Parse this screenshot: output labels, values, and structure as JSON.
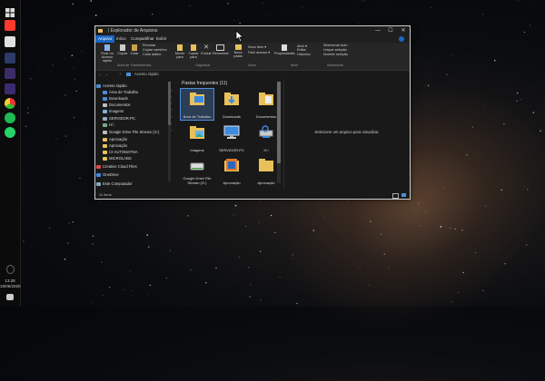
{
  "window": {
    "title": "| Explorador de Arquivos",
    "controls": {
      "minimize": "—",
      "maximize": "☐",
      "close": "✕"
    }
  },
  "tabs": [
    "Arquivo",
    "Início",
    "Compartilhar",
    "Exibir"
  ],
  "ribbon": {
    "pin": "Fixar no Acesso rápido",
    "copy": "Copiar",
    "paste": "Colar",
    "cut": "Recortar",
    "copy_path": "Copiar caminho",
    "paste_shortcut": "Colar atalho",
    "move_to": "Mover para",
    "copy_to": "Copiar para",
    "delete": "Excluir",
    "rename": "Renomear",
    "new_folder": "Nova pasta",
    "new_item": "Novo item ▾",
    "easy_access": "Fácil acesso ▾",
    "properties": "Propriedades",
    "open": "Abrir ▾",
    "edit": "Editar",
    "history": "Histórico",
    "select_all": "Selecionar tudo",
    "select_none": "Limpar seleção",
    "invert_selection": "Inverter seleção",
    "group_clipboard": "Área de Transferência",
    "group_organize": "Organizar",
    "group_new": "Novo",
    "group_open": "Abrir",
    "group_select": "Selecionar"
  },
  "address": {
    "path": "Acesso rápido"
  },
  "nav": [
    {
      "label": "Acesso rápido",
      "pinned": false
    },
    {
      "label": "Área de Trabalho",
      "pinned": true
    },
    {
      "label": "Downloads",
      "pinned": true
    },
    {
      "label": "Documentos",
      "pinned": true
    },
    {
      "label": "Imagens",
      "pinned": true
    },
    {
      "label": "SERVIDOR-PC",
      "pinned": true
    },
    {
      "label": "H:\\",
      "pinned": true
    },
    {
      "label": "Google Drive File Stream (G:)",
      "pinned": true
    },
    {
      "label": "Aprovação",
      "pinned": false
    },
    {
      "label": "Aprovação",
      "pinned": false
    },
    {
      "label": "CI-AUTOMATNA",
      "pinned": false
    },
    {
      "label": "MICROLABS",
      "pinned": false
    },
    {
      "label": "Creative Cloud Files",
      "pinned": false
    },
    {
      "label": "OneDrive",
      "pinned": false
    },
    {
      "label": "Este Computador",
      "pinned": false
    }
  ],
  "frequent": {
    "title": "Pastas frequentes (11)",
    "items": [
      {
        "label": "Área de Trabalho",
        "icon": "desktop-folder-icon"
      },
      {
        "label": "Downloads",
        "icon": "downloads-folder-icon"
      },
      {
        "label": "Documentos",
        "icon": "documents-folder-icon"
      },
      {
        "label": "Imagens",
        "icon": "pictures-folder-icon"
      },
      {
        "label": "SERVIDOR-PC",
        "icon": "computer-icon"
      },
      {
        "label": "H:\\",
        "icon": "network-drive-icon"
      },
      {
        "label": "Google Drive File Stream (G:)",
        "icon": "drive-icon"
      },
      {
        "label": "Aprovação",
        "icon": "thumbnail-folder-icon"
      },
      {
        "label": "Aprovação",
        "icon": "folder-icon"
      }
    ]
  },
  "preview": {
    "message": "Selecione um arquivo para visualizar."
  },
  "status": {
    "count": "11 itens"
  },
  "clock": {
    "time": "13:28",
    "date": "19/06/2020"
  },
  "colors": {
    "accent": "#1a66c2",
    "folder": "#e8c15a",
    "window_bg": "#191919"
  }
}
